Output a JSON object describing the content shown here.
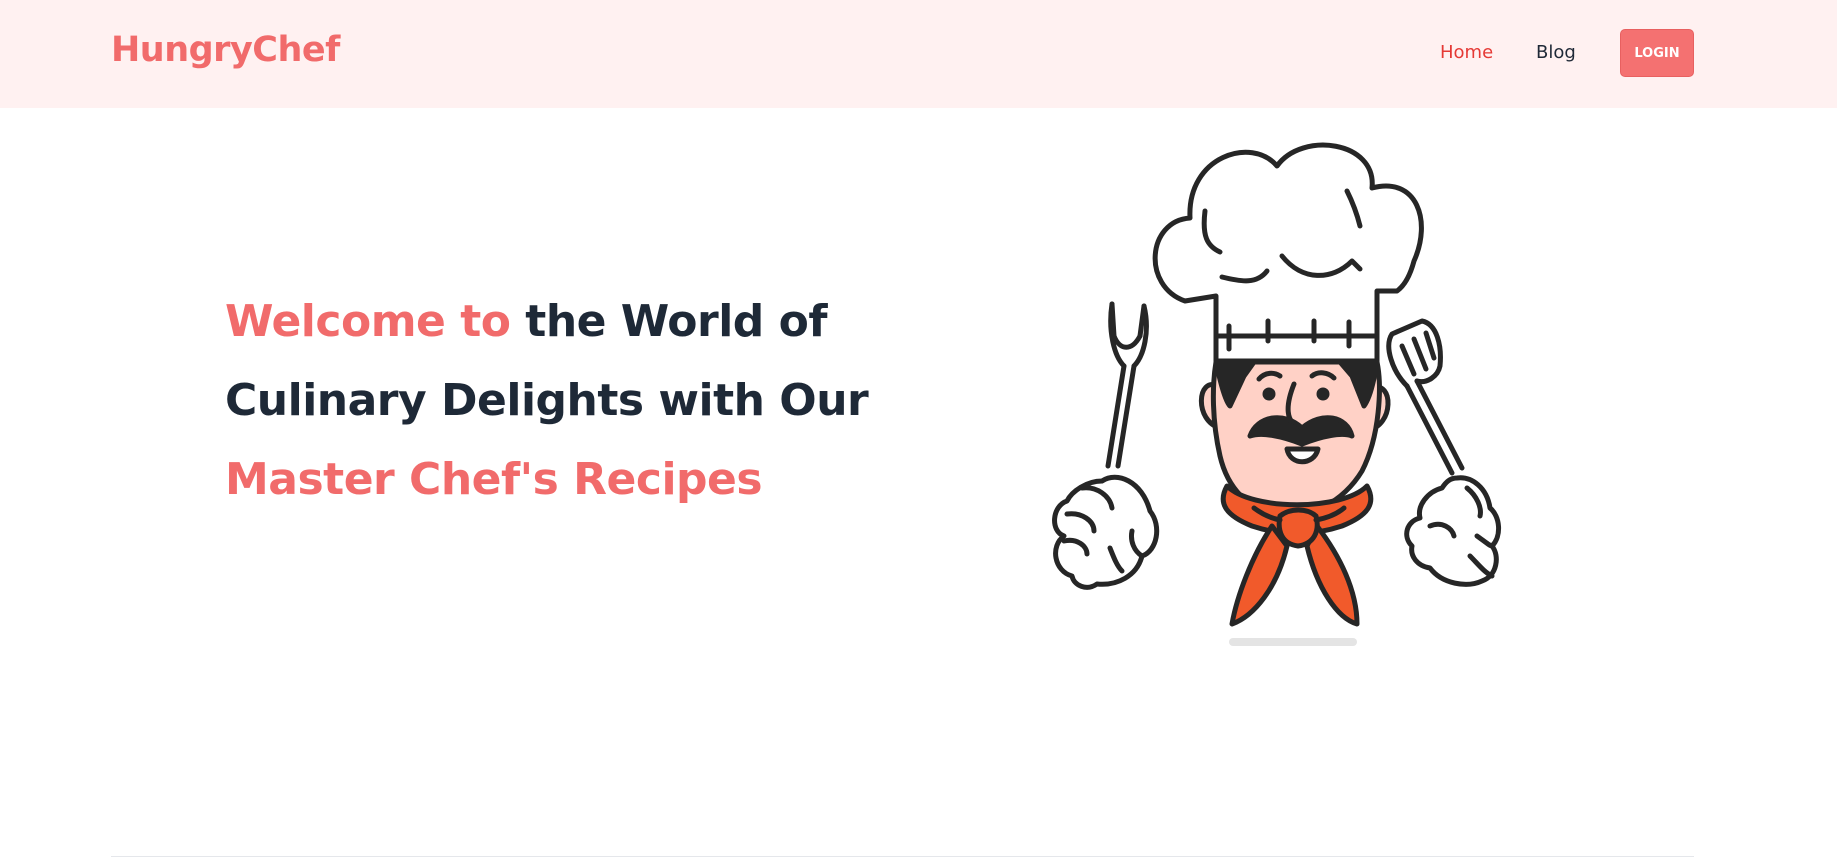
{
  "nav": {
    "logo": "HungryChef",
    "links": [
      {
        "label": "Home"
      },
      {
        "label": "Blog"
      }
    ],
    "login_label": "LOGIN"
  },
  "hero": {
    "title_part1": "Welcome to",
    "title_part2": " the World of",
    "title_part3": "Culinary Delights with Our",
    "title_part4": "Master Chef's Recipes"
  },
  "colors": {
    "accent": "#f16b6b",
    "nav_bg": "#fff1f1",
    "text_dark": "#1e2937",
    "scarf": "#f15a2b",
    "skin": "#ffd1c6"
  },
  "illustration": {
    "icon": "chef-icon"
  }
}
